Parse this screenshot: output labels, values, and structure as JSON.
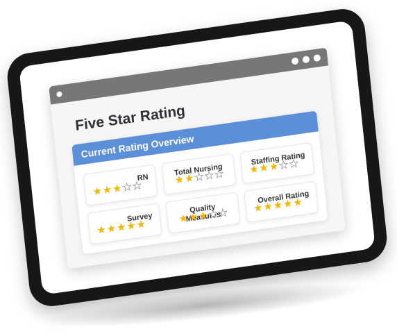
{
  "window": {
    "title": "Five Star Rating"
  },
  "panel": {
    "header": "Current Rating Overview"
  },
  "ratings": [
    {
      "label": "RN",
      "stars": 3
    },
    {
      "label": "Total Nursing",
      "stars": 2
    },
    {
      "label": "Staffing Rating",
      "stars": 3
    },
    {
      "label": "Survey",
      "stars": 5
    },
    {
      "label": "Quality Measures",
      "stars": 3
    },
    {
      "label": "Overall Rating",
      "stars": 5
    }
  ],
  "max_stars": 5,
  "colors": {
    "header": "#5b8fd8",
    "star_filled": "#f5b700",
    "titlebar": "#777777",
    "tablet": "#171717"
  }
}
